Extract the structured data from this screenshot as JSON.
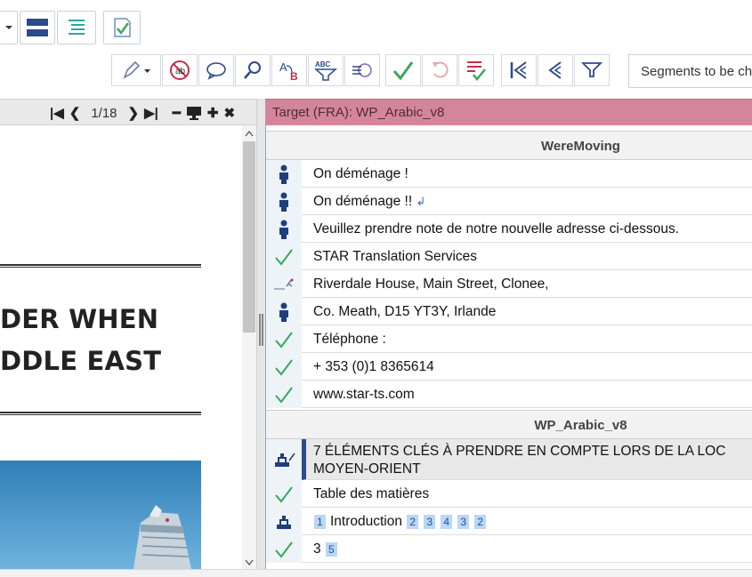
{
  "toolbar": {
    "filter_label": "Segments to be ch"
  },
  "preview": {
    "page_indicator": "1/18",
    "heading_line1": "DER WHEN",
    "heading_line2": "DDLE EAST"
  },
  "target": {
    "header": "Target (FRA): WP_Arabic_v8",
    "groups": [
      {
        "title": "WereMoving",
        "rows": [
          {
            "status": "person",
            "text": "On déménage !"
          },
          {
            "status": "person",
            "text": "On déménage !!"
          },
          {
            "status": "person",
            "text": "Veuillez prendre note de notre nouvelle adresse ci-dessous."
          },
          {
            "status": "check",
            "text": "STAR Translation Services"
          },
          {
            "status": "edit",
            "text": "Riverdale House, Main Street, Clonee,"
          },
          {
            "status": "person",
            "text": "Co. Meath, D15 YT3Y, Irlande"
          },
          {
            "status": "check",
            "text": "Téléphone :"
          },
          {
            "status": "check",
            "text": "+ 353 (0)1 8365614"
          },
          {
            "status": "check",
            "text": "www.star-ts.com"
          }
        ]
      },
      {
        "title": "WP_Arabic_v8",
        "rows": [
          {
            "status": "stamp",
            "text": "7 ÉLÉMENTS CLÉS À PRENDRE EN COMPTE LORS DE LA LOC MOYEN-ORIENT"
          },
          {
            "status": "check",
            "text": "Table des matières"
          },
          {
            "status": "stamp",
            "text": "Introduction",
            "tags": [
              "1",
              "2",
              "3",
              "4",
              "3",
              "2"
            ]
          },
          {
            "status": "check",
            "text": "3",
            "tags": [
              "5"
            ]
          }
        ]
      }
    ]
  },
  "colors": {
    "target_header_bg": "#d5859b",
    "check_green": "#3aa757",
    "person_blue": "#1f3f7a",
    "tag_bg": "#bcd6f5"
  }
}
